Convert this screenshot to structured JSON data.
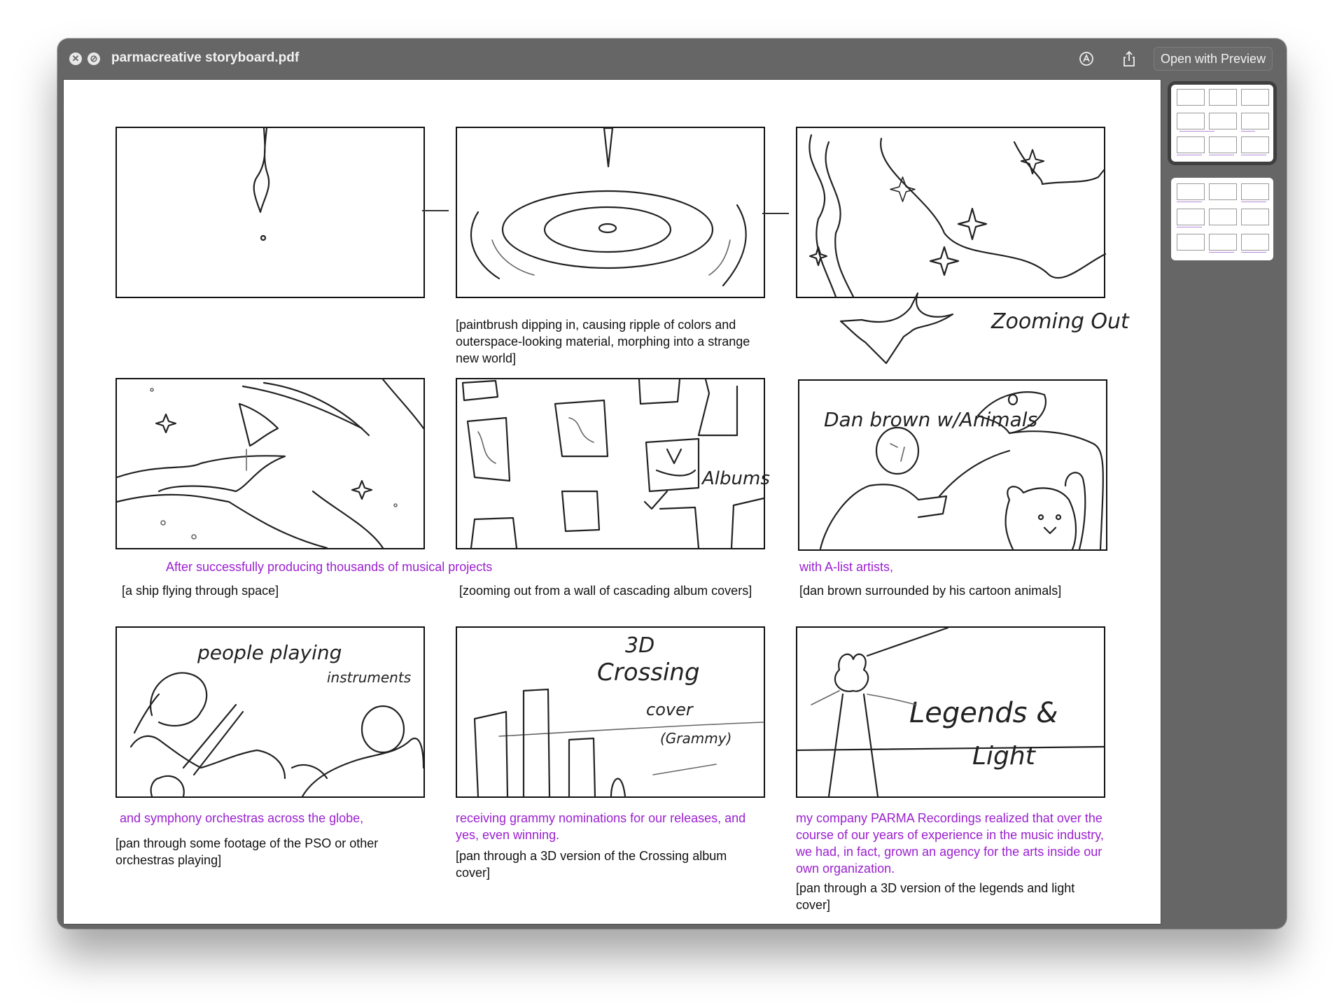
{
  "window": {
    "title": "parmacreative storyboard.pdf",
    "open_with_preview": "Open with Preview"
  },
  "page": {
    "frame1": {
      "caption": ""
    },
    "frame2": {
      "caption": "[paintbrush dipping in, causing ripple of colors and outerspace-looking material, morphing into a strange new world]"
    },
    "frame3": {
      "sketch_label": "Zooming Out"
    },
    "frame4": {
      "caption": "[a ship flying through space]"
    },
    "frame5": {
      "sketch_label": "Albums",
      "caption": "[zooming out from a wall of cascading album covers]"
    },
    "frame6": {
      "sketch_label": "Dan brown w/Animals",
      "caption": "[dan brown surrounded by his cartoon animals]"
    },
    "frame7": {
      "sketch_label_1": "people playing",
      "sketch_label_2": "instruments",
      "caption": "[pan through some footage of the PSO or other orchestras playing]"
    },
    "frame8": {
      "sketch_label_1": "3D",
      "sketch_label_2": "Crossing",
      "sketch_label_3": "cover",
      "sketch_label_4": "(Grammy)",
      "caption": "[pan through a 3D version of the Crossing album cover]"
    },
    "frame9": {
      "sketch_label_1": "Legends &",
      "sketch_label_2": "Light",
      "caption": "[pan through a 3D version of the legends and light cover]"
    },
    "narration": {
      "row2_left": "After successfully producing thousands of musical projects",
      "row2_right": "with A-list artists,",
      "row3_left": "and symphony orchestras across the globe,",
      "row3_mid": "receiving grammy nominations for our releases, and yes, even winning.",
      "row3_right": "my company PARMA Recordings realized that over the course of our years of experience in the music industry, we had, in fact, grown an agency for the arts inside our own organization."
    }
  },
  "colors": {
    "narration": "#9b1fd0",
    "window_chrome": "#666666"
  },
  "icons": [
    "close-icon",
    "rotate-icon",
    "markup-icon",
    "share-icon"
  ]
}
